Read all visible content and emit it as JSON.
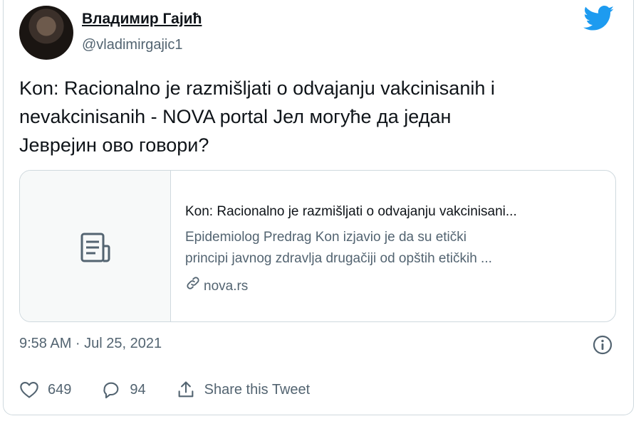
{
  "author": {
    "name": "Владимир Гајић",
    "handle": "@vladimirgajic1"
  },
  "tweet": {
    "line1": "Kon: Racionalno je razmišljati o odvajanju vakcinisanih i",
    "line2": "nevakcinisanih - NOVA portal Јел могуће да један",
    "line3": "Јеврејин ово говори?"
  },
  "card": {
    "title": "Kon: Racionalno je razmišljati o odvajanju vakcinisani...",
    "desc_line1": "Epidemiolog Predrag Kon izjavio je da su etički",
    "desc_line2": "principi javnog zdravlja drugačiji od opštih etičkih ...",
    "domain": "nova.rs"
  },
  "timestamp": "9:58 AM · Jul 25, 2021",
  "actions": {
    "likes": "649",
    "replies": "94",
    "share_label": "Share this Tweet"
  },
  "icons": {
    "brand": "twitter-bird-icon",
    "thumb": "document-icon",
    "link": "link-icon",
    "info": "info-icon",
    "like": "heart-icon",
    "reply": "reply-icon",
    "share": "share-icon"
  },
  "colors": {
    "brand": "#1d9bf0",
    "text": "#0f1419",
    "secondary": "#536471",
    "border": "#cfd9de"
  }
}
